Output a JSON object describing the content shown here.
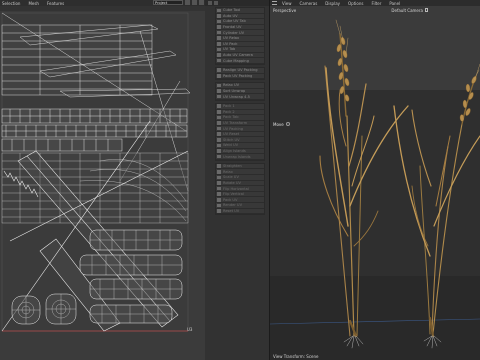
{
  "uv_editor": {
    "menu": [
      "Selection",
      "Mesh",
      "Features"
    ],
    "projection_mode": "Project",
    "value_readout": "U3"
  },
  "command_palette": {
    "groups": [
      {
        "items": [
          "Cube Tool",
          "Auto UV",
          "Cube UV Tab",
          "Frontal UV",
          "Cylinder UV",
          "UV Relax",
          "UV Pack",
          "UV Tab",
          "Auto UV Camera",
          "Cube Mapping"
        ]
      },
      {
        "items": [
          "Realign UV Packing",
          "Pack UV Packing"
        ]
      },
      {
        "items": [
          "Relax UV",
          "Sort Unwrap",
          "UV Unwrap 4.5"
        ]
      },
      {
        "items": [
          "Pack 1",
          "Pack 2",
          "Pack Tab",
          "UV Transform",
          "UV Packing",
          "UV Reset",
          "Stitch UV",
          "Weld UV",
          "Align Islands",
          "Unwrap Islands"
        ]
      },
      {
        "items": [
          "Straighten",
          "Relax",
          "Scale UV",
          "Rotate UV",
          "Flip Horizontal",
          "Flip Vertical",
          "Pack UV",
          "Render UV",
          "Reset UV"
        ]
      }
    ]
  },
  "viewport": {
    "menu": [
      "View",
      "Cameras",
      "Display",
      "Options",
      "Filter",
      "Panel"
    ],
    "projection": "Perspective",
    "camera": "Default Camera",
    "hud_move": "Move",
    "status": "View Transform: Scene"
  }
}
